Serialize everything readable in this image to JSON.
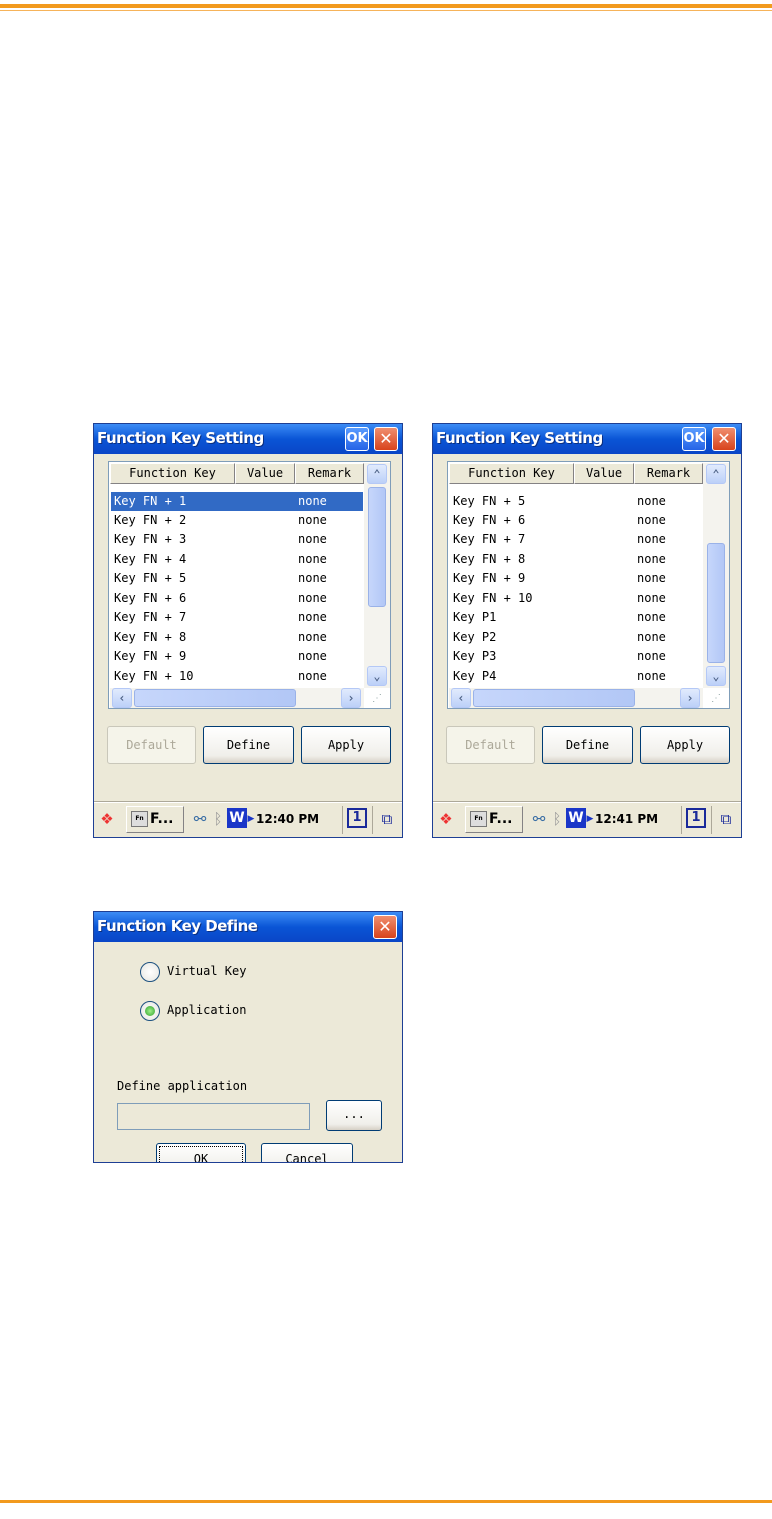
{
  "window1": {
    "title": "Function Key Setting",
    "ok": "OK",
    "close": "✕",
    "columns": [
      "Function Key",
      "Value",
      "Remark"
    ],
    "rows": [
      {
        "key": "Key FN + 1",
        "value": "",
        "remark": "none",
        "selected": true
      },
      {
        "key": "Key FN + 2",
        "value": "",
        "remark": "none"
      },
      {
        "key": "Key FN + 3",
        "value": "",
        "remark": "none"
      },
      {
        "key": "Key FN + 4",
        "value": "",
        "remark": "none"
      },
      {
        "key": "Key FN + 5",
        "value": "",
        "remark": "none"
      },
      {
        "key": "Key FN + 6",
        "value": "",
        "remark": "none"
      },
      {
        "key": "Key FN + 7",
        "value": "",
        "remark": "none"
      },
      {
        "key": "Key FN + 8",
        "value": "",
        "remark": "none"
      },
      {
        "key": "Key FN + 9",
        "value": "",
        "remark": "none"
      },
      {
        "key": "Key FN + 10",
        "value": "",
        "remark": "none"
      }
    ],
    "buttons": {
      "default": "Default",
      "define": "Define",
      "apply": "Apply"
    },
    "taskbar": {
      "app": "F...",
      "w": "W",
      "time": "12:40 PM",
      "desk": "1"
    }
  },
  "window2": {
    "title": "Function Key Setting",
    "ok": "OK",
    "close": "✕",
    "columns": [
      "Function Key",
      "Value",
      "Remark"
    ],
    "rows": [
      {
        "key": "Key FN + 5",
        "value": "",
        "remark": "none"
      },
      {
        "key": "Key FN + 6",
        "value": "",
        "remark": "none"
      },
      {
        "key": "Key FN + 7",
        "value": "",
        "remark": "none"
      },
      {
        "key": "Key FN + 8",
        "value": "",
        "remark": "none"
      },
      {
        "key": "Key FN + 9",
        "value": "",
        "remark": "none"
      },
      {
        "key": "Key FN + 10",
        "value": "",
        "remark": "none"
      },
      {
        "key": "Key P1",
        "value": "",
        "remark": "none"
      },
      {
        "key": "Key P2",
        "value": "",
        "remark": "none"
      },
      {
        "key": "Key P3",
        "value": "",
        "remark": "none"
      },
      {
        "key": "Key P4",
        "value": "",
        "remark": "none"
      }
    ],
    "buttons": {
      "default": "Default",
      "define": "Define",
      "apply": "Apply"
    },
    "taskbar": {
      "app": "F...",
      "w": "W",
      "time": "12:41 PM",
      "desk": "1"
    }
  },
  "define": {
    "title": "Function Key Define",
    "close": "✕",
    "virtual_key": "Virtual Key",
    "application": "Application",
    "selected": "Application",
    "define_label": "Define application",
    "path_value": "",
    "browse": "...",
    "ok": "OK",
    "cancel": "Cancel"
  }
}
